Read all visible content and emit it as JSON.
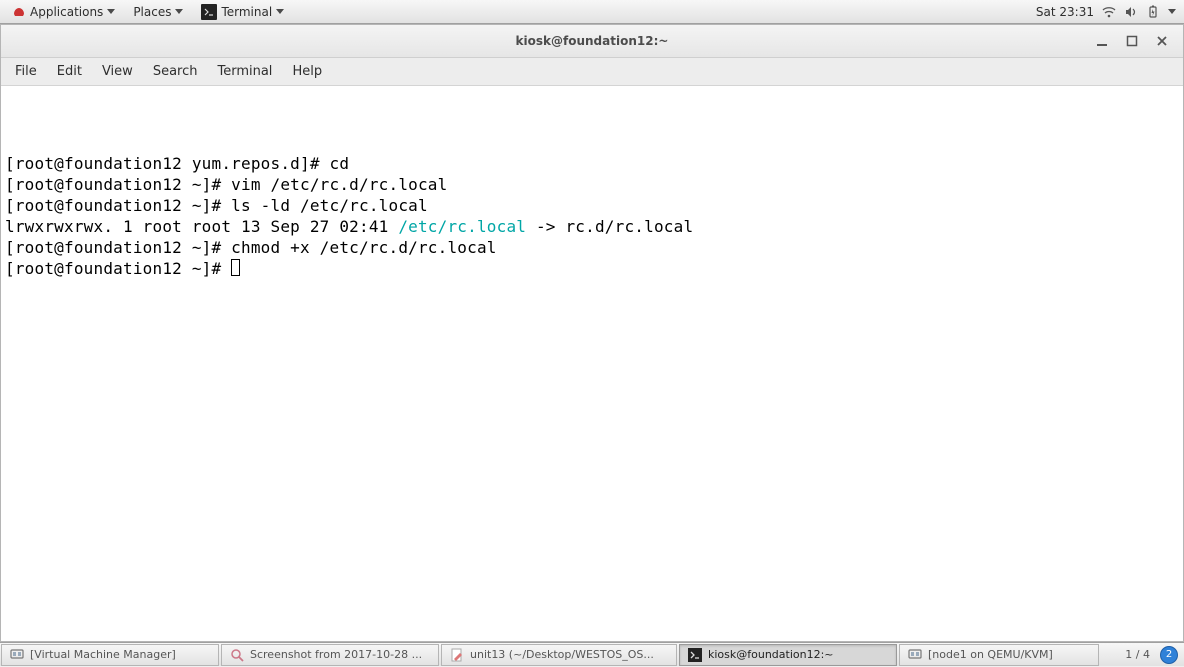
{
  "top_panel": {
    "applications": "Applications",
    "places": "Places",
    "current_app": "Terminal",
    "clock": "Sat 23:31"
  },
  "window": {
    "title": "kiosk@foundation12:~",
    "menubar": [
      "File",
      "Edit",
      "View",
      "Search",
      "Terminal",
      "Help"
    ]
  },
  "terminal": {
    "lines": [
      {
        "prompt": "[root@foundation12 yum.repos.d]# ",
        "cmd": "cd"
      },
      {
        "prompt": "[root@foundation12 ~]# ",
        "cmd": "vim /etc/rc.d/rc.local"
      },
      {
        "prompt": "[root@foundation12 ~]# ",
        "cmd": "ls -ld /etc/rc.local"
      },
      {
        "output_pre": "lrwxrwxrwx. 1 root root 13 Sep 27 02:41 ",
        "output_link": "/etc/rc.local",
        "output_post": " -> rc.d/rc.local"
      },
      {
        "prompt": "[root@foundation12 ~]# ",
        "cmd": "chmod +x /etc/rc.d/rc.local"
      },
      {
        "prompt": "[root@foundation12 ~]# ",
        "cursor": true
      }
    ]
  },
  "taskbar": {
    "items": [
      {
        "label": "[Virtual Machine Manager]",
        "icon": "vm-icon"
      },
      {
        "label": "Screenshot from 2017-10-28 ...",
        "icon": "magnifier-icon"
      },
      {
        "label": "unit13 (~/Desktop/WESTOS_OS...",
        "icon": "editor-icon"
      },
      {
        "label": "kiosk@foundation12:~",
        "icon": "terminal-icon",
        "active": true
      },
      {
        "label": "[node1 on QEMU/KVM]",
        "icon": "vm-icon"
      }
    ],
    "workspace": "1 / 4",
    "badge": "2"
  }
}
